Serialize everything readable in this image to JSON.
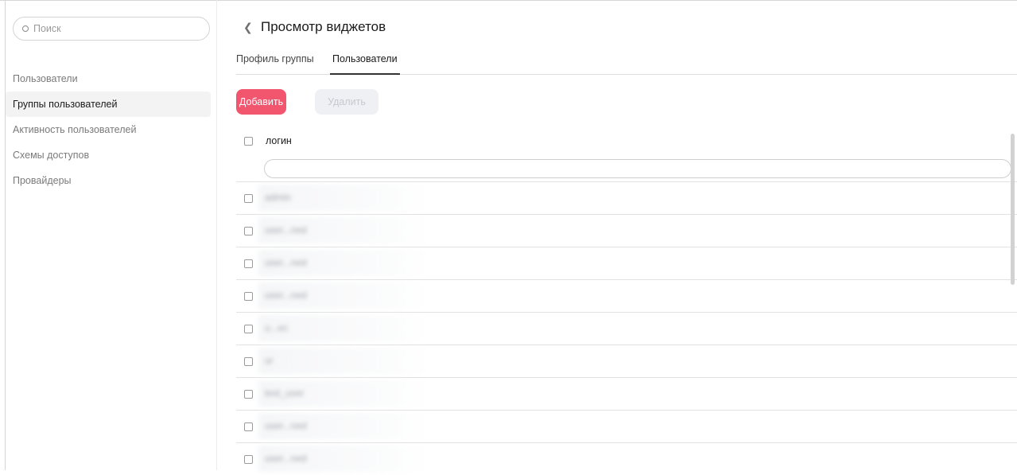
{
  "sidebar": {
    "search_placeholder": "Поиск",
    "items": [
      {
        "label": "Пользователи",
        "active": false
      },
      {
        "label": "Группы пользователей",
        "active": true
      },
      {
        "label": "Активность пользователей",
        "active": false
      },
      {
        "label": "Схемы доступов",
        "active": false
      },
      {
        "label": "Провайдеры",
        "active": false
      }
    ]
  },
  "header": {
    "back_icon": "chevron-left-icon",
    "title": "Просмотр виджетов"
  },
  "tabs": [
    {
      "label": "Профиль группы",
      "active": false
    },
    {
      "label": "Пользователи",
      "active": true
    }
  ],
  "toolbar": {
    "add_label": "Добавить",
    "delete_label": "Удалить"
  },
  "table": {
    "column_header": "логин",
    "filter_value": "",
    "rows": [
      {
        "login": "admin"
      },
      {
        "login": "user...ned"
      },
      {
        "login": "user...ned"
      },
      {
        "login": "user...ned"
      },
      {
        "login": "u...ec"
      },
      {
        "login": "ur"
      },
      {
        "login": "test_user"
      },
      {
        "login": "user...ned"
      },
      {
        "login": "user...ned"
      }
    ]
  },
  "colors": {
    "accent": "#f2566f",
    "disabled_button_bg": "#eef0f3",
    "active_nav_bg": "#f3f3f3"
  }
}
